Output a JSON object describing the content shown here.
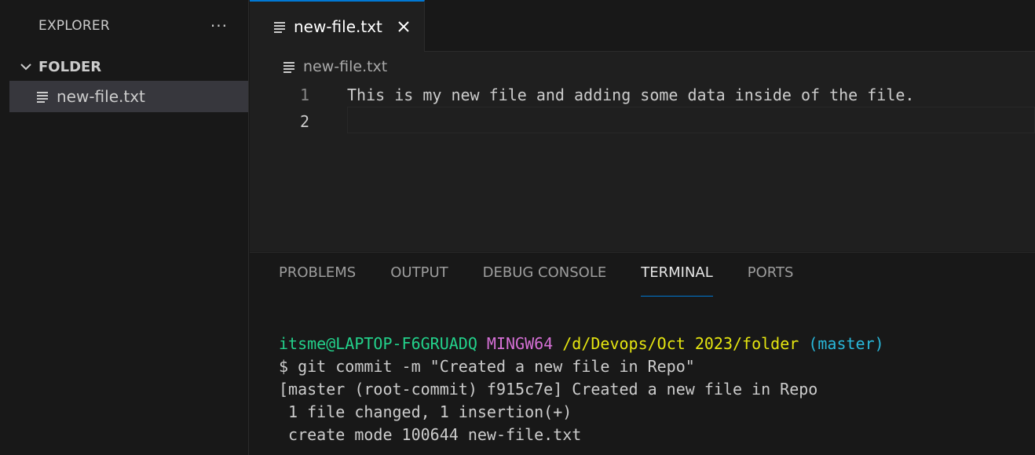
{
  "sidebar": {
    "title": "EXPLORER",
    "more_label": "···",
    "folder_label": "FOLDER",
    "file_label": "new-file.txt"
  },
  "editor": {
    "tab_label": "new-file.txt",
    "breadcrumb_label": "new-file.txt",
    "lines": [
      {
        "number": "1",
        "text": "This is my new file and adding some data inside of the file."
      },
      {
        "number": "2",
        "text": ""
      }
    ]
  },
  "panel": {
    "tabs": [
      "PROBLEMS",
      "OUTPUT",
      "DEBUG CONSOLE",
      "TERMINAL",
      "PORTS"
    ],
    "active_tab": "TERMINAL"
  },
  "terminal": {
    "prompt_user": "itsme@LAPTOP-F6GRUADQ",
    "prompt_env": "MINGW64",
    "prompt_path": "/d/Devops/Oct 2023/folder",
    "prompt_branch": "(master)",
    "command": "$ git commit -m \"Created a new file in Repo\"",
    "output": [
      "[master (root-commit) f915c7e] Created a new file in Repo",
      " 1 file changed, 1 insertion(+)",
      " create mode 100644 new-file.txt"
    ]
  },
  "colors": {
    "accent": "#0078d4",
    "terminal_user": "#23d18b",
    "terminal_env": "#d670d6",
    "terminal_path": "#e5e510",
    "terminal_branch": "#29b8db"
  }
}
